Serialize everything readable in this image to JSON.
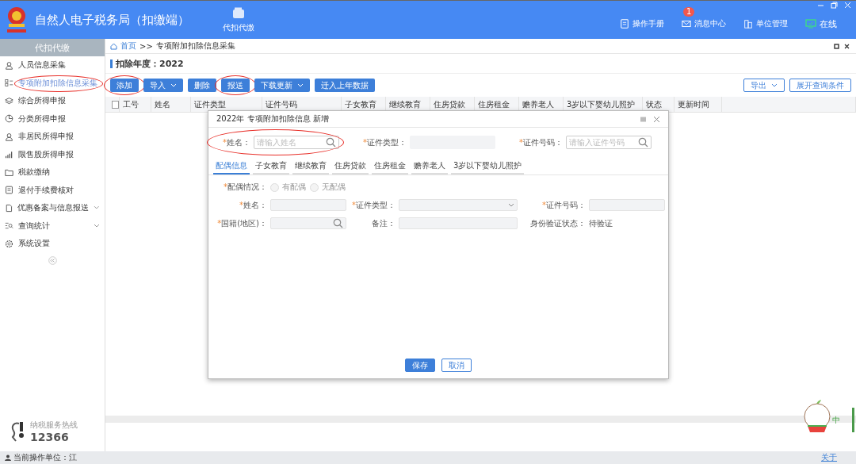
{
  "header": {
    "title": "自然人电子税务局（扣缴端）",
    "modules": [
      {
        "label": "代扣代缴",
        "selected": true
      }
    ],
    "actions": [
      {
        "label": "操作手册",
        "kind": "manual"
      },
      {
        "label": "消息中心",
        "kind": "message",
        "badge": "1"
      },
      {
        "label": "单位管理",
        "kind": "company"
      },
      {
        "label": "在线",
        "kind": "online"
      }
    ]
  },
  "sidebar": {
    "title": "代扣代缴",
    "items": [
      {
        "label": "人员信息采集",
        "selected": false,
        "expandable": false
      },
      {
        "label": "专项附加扣除信息采集",
        "selected": true,
        "expandable": false,
        "circled": true
      },
      {
        "label": "综合所得申报",
        "selected": false,
        "expandable": false
      },
      {
        "label": "分类所得申报",
        "selected": false,
        "expandable": false
      },
      {
        "label": "非居民所得申报",
        "selected": false,
        "expandable": false
      },
      {
        "label": "限售股所得申报",
        "selected": false,
        "expandable": false
      },
      {
        "label": "税款缴纳",
        "selected": false,
        "expandable": false
      },
      {
        "label": "退付手续费核对",
        "selected": false,
        "expandable": false
      },
      {
        "label": "优惠备案与信息报送",
        "selected": false,
        "expandable": true
      },
      {
        "label": "查询统计",
        "selected": false,
        "expandable": true
      },
      {
        "label": "系统设置",
        "selected": false,
        "expandable": false
      }
    ],
    "hotline": {
      "label": "纳税服务热线",
      "number": "12366"
    }
  },
  "breadcrumb": [
    "首页",
    ">>",
    "专项附加扣除信息采集"
  ],
  "year_title": "扣除年度：2022",
  "toolbar": {
    "left": [
      {
        "label": "添加",
        "dropdown": false,
        "circled": true
      },
      {
        "label": "导入",
        "dropdown": true
      },
      {
        "label": "删除",
        "dropdown": false
      },
      {
        "label": "报送",
        "dropdown": false,
        "circled": true
      },
      {
        "label": "下载更新",
        "dropdown": true
      },
      {
        "label": "迁入上年数据",
        "dropdown": false
      }
    ],
    "right": [
      {
        "label": "导出",
        "dropdown": true
      },
      {
        "label": "展开查询条件",
        "dropdown": false
      }
    ]
  },
  "table": {
    "select_all": {
      "checked": false
    },
    "columns": [
      "工号",
      "姓名",
      "证件类型",
      "证件号码",
      "子女教育",
      "继续教育",
      "住房贷款",
      "住房租金",
      "赡养老人",
      "3岁以下婴幼儿照护",
      "状态",
      "更新时间"
    ]
  },
  "dialog": {
    "title": "2022年 专项附加扣除信息 新增",
    "search": [
      {
        "label": "*姓名：",
        "kind": "search",
        "placeholder": "请输入姓名",
        "circled": true
      },
      {
        "label": "*证件类型：",
        "kind": "plain"
      },
      {
        "label": "*证件号码：",
        "kind": "search",
        "placeholder": "请输入证件号码"
      }
    ],
    "tabs": [
      {
        "label": "配偶信息",
        "selected": true
      },
      {
        "label": "子女教育",
        "selected": false
      },
      {
        "label": "继续教育",
        "selected": false
      },
      {
        "label": "住房贷款",
        "selected": false
      },
      {
        "label": "住房租金",
        "selected": false
      },
      {
        "label": "赡养老人",
        "selected": false
      },
      {
        "label": "3岁以下婴幼儿照护",
        "selected": false
      }
    ],
    "spouse_status": {
      "label": "*配偶情况：",
      "options": [
        {
          "label": "有配偶",
          "selected": false
        },
        {
          "label": "无配偶",
          "selected": false
        }
      ]
    },
    "fields": [
      {
        "label": "*姓名：",
        "kind": "text"
      },
      {
        "label": "*证件类型：",
        "kind": "select"
      },
      {
        "label": "*证件号码：",
        "kind": "text"
      },
      {
        "label": "*国籍(地区)：",
        "kind": "search"
      },
      {
        "label": "备注：",
        "kind": "text"
      },
      {
        "label": "身份验证状态：",
        "kind": "status",
        "value": "待验证"
      }
    ],
    "buttons": [
      {
        "label": "保存",
        "primary": true
      },
      {
        "label": "取消",
        "primary": false
      }
    ]
  },
  "status_bar": {
    "unit": "当前操作单位：江",
    "ime": "中",
    "about": "关于"
  }
}
